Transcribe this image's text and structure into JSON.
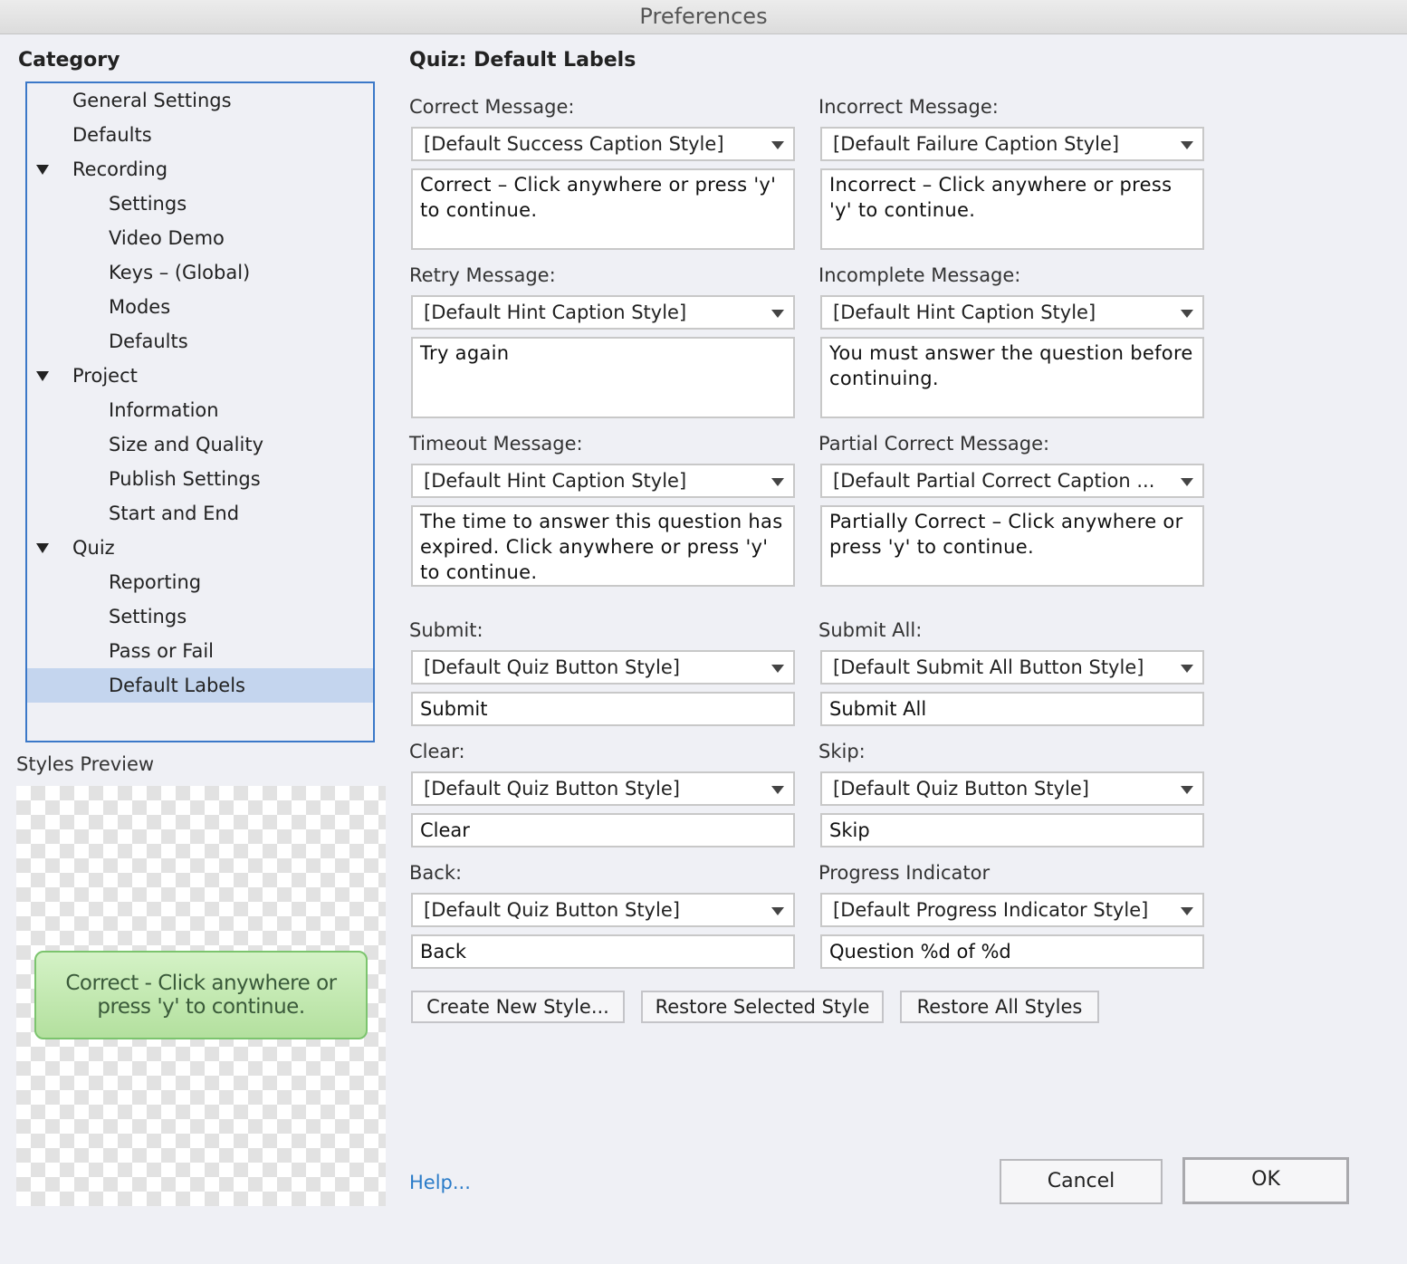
{
  "window": {
    "title": "Preferences"
  },
  "category": {
    "heading": "Category",
    "items": [
      {
        "label": "General Settings"
      },
      {
        "label": "Defaults"
      },
      {
        "label": "Recording"
      },
      {
        "label": "Settings"
      },
      {
        "label": "Video Demo"
      },
      {
        "label": "Keys – (Global)"
      },
      {
        "label": "Modes"
      },
      {
        "label": "Defaults"
      },
      {
        "label": "Project"
      },
      {
        "label": "Information"
      },
      {
        "label": "Size and Quality"
      },
      {
        "label": "Publish Settings"
      },
      {
        "label": "Start and End"
      },
      {
        "label": "Quiz"
      },
      {
        "label": "Reporting"
      },
      {
        "label": "Settings"
      },
      {
        "label": "Pass or Fail"
      },
      {
        "label": "Default Labels"
      }
    ],
    "selected": "Default Labels"
  },
  "preview": {
    "heading": "Styles Preview",
    "caption_text": "Correct - Click anywhere or press 'y' to continue."
  },
  "panel": {
    "title": "Quiz: Default Labels",
    "fields": {
      "correct": {
        "label": "Correct Message:",
        "style": "[Default Success Caption Style]",
        "text": "Correct – Click anywhere or press 'y' to continue."
      },
      "incorrect": {
        "label": "Incorrect Message:",
        "style": "[Default Failure Caption Style]",
        "text": "Incorrect – Click anywhere or press 'y' to continue."
      },
      "retry": {
        "label": "Retry Message:",
        "style": "[Default Hint Caption Style]",
        "text": "Try again"
      },
      "incomplete": {
        "label": "Incomplete Message:",
        "style": "[Default Hint Caption Style]",
        "text": "You must answer the question before continuing."
      },
      "timeout": {
        "label": "Timeout Message:",
        "style": "[Default Hint Caption Style]",
        "text": "The time to answer this question has expired. Click anywhere or press 'y' to continue."
      },
      "partial": {
        "label": "Partial Correct Message:",
        "style": "[Default Partial Correct Caption ...",
        "text": "Partially Correct – Click anywhere or press 'y' to continue."
      },
      "submit": {
        "label": "Submit:",
        "style": "[Default Quiz Button Style]",
        "text": "Submit"
      },
      "submit_all": {
        "label": "Submit All:",
        "style": "[Default Submit All Button Style]",
        "text": "Submit All"
      },
      "clear": {
        "label": "Clear:",
        "style": "[Default Quiz Button Style]",
        "text": "Clear"
      },
      "skip": {
        "label": "Skip:",
        "style": "[Default Quiz Button Style]",
        "text": "Skip"
      },
      "back": {
        "label": "Back:",
        "style": "[Default Quiz Button Style]",
        "text": "Back"
      },
      "progress": {
        "label": "Progress Indicator",
        "style": "[Default Progress Indicator Style]",
        "text": "Question %d of %d"
      }
    },
    "buttons": {
      "create_new_style": "Create New Style...",
      "restore_selected_style": "Restore Selected Style",
      "restore_all_styles": "Restore All Styles"
    }
  },
  "footer": {
    "help": "Help...",
    "cancel": "Cancel",
    "ok": "OK"
  },
  "colors": {
    "background": "#eff0f5",
    "selection": "#c4d5ee",
    "tree_border": "#3b78c8",
    "link": "#2a7bc8",
    "preview_caption": "#b3e09e"
  }
}
